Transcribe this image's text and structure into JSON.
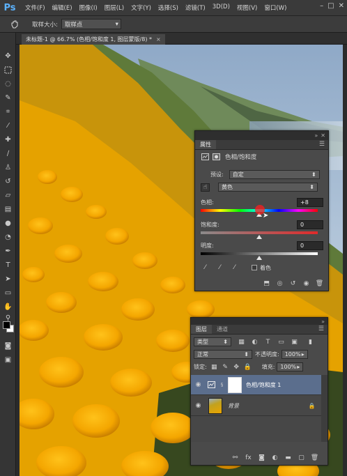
{
  "app": {
    "logo": "Ps"
  },
  "menu": [
    "文件(F)",
    "编辑(E)",
    "图像(I)",
    "图层(L)",
    "文字(Y)",
    "选择(S)",
    "滤镜(T)",
    "3D(D)",
    "视图(V)",
    "窗口(W)"
  ],
  "window_controls": [
    "–",
    "□",
    "✕"
  ],
  "options": {
    "sample_size_label": "取样大小:",
    "sample_size_value": "取样点"
  },
  "document": {
    "tab_title": "未标题-1 @ 66.7% (色相/饱和度 1, 图层蒙版/8) *",
    "close": "×"
  },
  "properties": {
    "tab_label": "属性",
    "header_title": "色相/饱和度",
    "preset_label": "预设:",
    "preset_value": "自定",
    "channel_value": "黄色",
    "hue_label": "色相:",
    "hue_value": "+8",
    "hue_level": 0.5,
    "saturation_label": "饱和度:",
    "saturation_value": "0",
    "lightness_label": "明度:",
    "lightness_value": "0",
    "colorize_label": "着色"
  },
  "layers": {
    "tabs": [
      "图层",
      "通道"
    ],
    "filter_kind": "类型",
    "blend_mode": "正常",
    "opacity_label": "不透明度:",
    "opacity_value": "100%",
    "lock_label": "锁定:",
    "fill_label": "填充:",
    "fill_value": "100%",
    "rows": [
      {
        "name": "色相/饱和度 1",
        "selected": true
      },
      {
        "name": "背景",
        "selected": false
      }
    ]
  },
  "colors": {
    "panel_bg": "#4a4a4a",
    "selected_row": "#5b6e8d",
    "spectrum_top": "linear",
    "accent": "#5cb3ff"
  }
}
